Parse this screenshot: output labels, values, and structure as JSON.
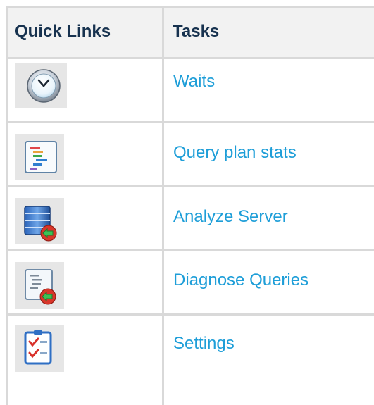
{
  "headers": {
    "quick_links": "Quick Links",
    "tasks": "Tasks"
  },
  "rows": [
    {
      "icon": "clock-icon",
      "label": "Waits"
    },
    {
      "icon": "query-plan-icon",
      "label": "Query plan stats"
    },
    {
      "icon": "server-analyze-icon",
      "label": "Analyze Server"
    },
    {
      "icon": "diagnose-queries-icon",
      "label": "Diagnose Queries"
    },
    {
      "icon": "settings-checklist-icon",
      "label": "Settings"
    }
  ],
  "colors": {
    "link": "#1e9ed8",
    "header_text": "#17324f",
    "header_bg": "#f2f2f2",
    "grid": "#d9d9d9"
  }
}
